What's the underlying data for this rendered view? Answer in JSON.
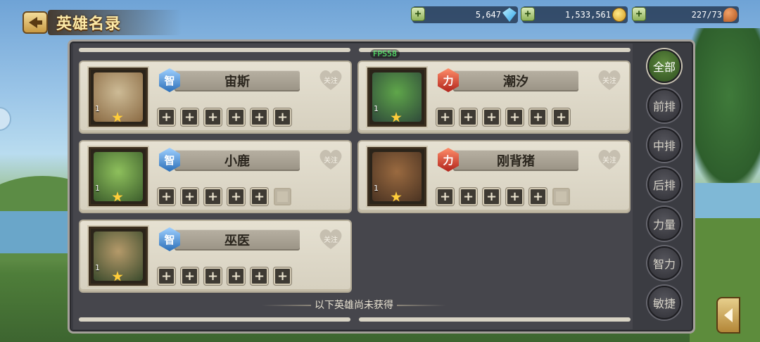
{
  "header": {
    "title": "英雄名录",
    "resources": [
      {
        "name": "gems",
        "value": "5,647",
        "icon": "diamond-icon"
      },
      {
        "name": "gold",
        "value": "1,533,561",
        "icon": "gold-coins-icon"
      },
      {
        "name": "stamina",
        "value": "227/73",
        "icon": "meat-icon"
      }
    ]
  },
  "debug": {
    "fps": "FPS58"
  },
  "heroes": [
    {
      "name": "宙斯",
      "attribute": "智",
      "attribute_type": "int",
      "level": "1",
      "stars": 1,
      "follow_label": "关注",
      "slots": [
        "+",
        "+",
        "+",
        "+",
        "+",
        "+"
      ],
      "art_colors": [
        "#8a6a43",
        "#cdbb96"
      ]
    },
    {
      "name": "潮汐",
      "attribute": "力",
      "attribute_type": "str",
      "level": "1",
      "stars": 1,
      "follow_label": "关注",
      "slots": [
        "+",
        "+",
        "+",
        "+",
        "+",
        "+"
      ],
      "art_colors": [
        "#2f4a3a",
        "#5fa64a"
      ]
    },
    {
      "name": "小鹿",
      "attribute": "智",
      "attribute_type": "int",
      "level": "1",
      "stars": 1,
      "follow_label": "关注",
      "slots": [
        "+",
        "+",
        "+",
        "+",
        "+",
        ""
      ],
      "art_colors": [
        "#3c5d2c",
        "#8ec05c"
      ]
    },
    {
      "name": "刚背猪",
      "attribute": "力",
      "attribute_type": "str",
      "level": "1",
      "stars": 1,
      "follow_label": "关注",
      "slots": [
        "+",
        "+",
        "+",
        "+",
        "+",
        ""
      ],
      "art_colors": [
        "#4a3322",
        "#9a6a40"
      ]
    },
    {
      "name": "巫医",
      "attribute": "智",
      "attribute_type": "int",
      "level": "1",
      "stars": 1,
      "follow_label": "关注",
      "slots": [
        "+",
        "+",
        "+",
        "+",
        "+",
        "+"
      ],
      "art_colors": [
        "#3a4a2c",
        "#b59a6a"
      ]
    }
  ],
  "divider_text": "以下英雄尚未获得",
  "filters": [
    {
      "label": "全部",
      "active": true
    },
    {
      "label": "前排",
      "active": false
    },
    {
      "label": "中排",
      "active": false
    },
    {
      "label": "后排",
      "active": false
    },
    {
      "label": "力量",
      "active": false
    },
    {
      "label": "智力",
      "active": false
    },
    {
      "label": "敏捷",
      "active": false
    }
  ]
}
